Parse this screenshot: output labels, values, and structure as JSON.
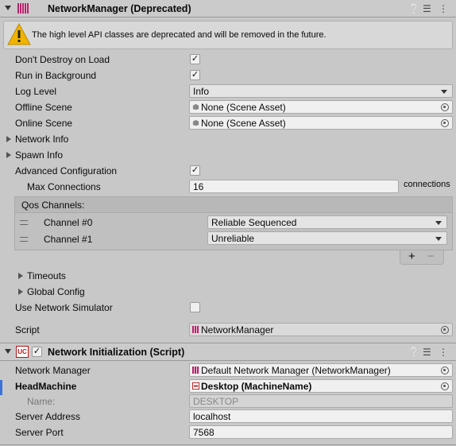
{
  "nm_component": {
    "title": "NetworkManager (Deprecated)",
    "warning": "The high level API classes are deprecated and will be removed in the future.",
    "dont_destroy_label": "Don't Destroy on Load",
    "run_bg_label": "Run in Background",
    "log_level_label": "Log Level",
    "log_level_value": "Info",
    "offline_scene_label": "Offline Scene",
    "offline_scene_value": "None (Scene Asset)",
    "online_scene_label": "Online Scene",
    "online_scene_value": "None (Scene Asset)",
    "network_info_label": "Network Info",
    "spawn_info_label": "Spawn Info",
    "adv_config_label": "Advanced Configuration",
    "max_conn_label": "Max Connections",
    "max_conn_value": "16",
    "max_conn_unit": "connections",
    "qos_label": "Qos Channels:",
    "channels": [
      {
        "label": "Channel #0",
        "value": "Reliable Sequenced"
      },
      {
        "label": "Channel #1",
        "value": "Unreliable"
      }
    ],
    "plus": "+",
    "minus": "−",
    "timeouts_label": "Timeouts",
    "global_config_label": "Global Config",
    "net_sim_label": "Use Network Simulator",
    "script_label": "Script",
    "script_value": "NetworkManager",
    "checkboxes": {
      "dont_destroy": true,
      "run_bg": true,
      "adv_config": true,
      "net_sim": false
    }
  },
  "ni_component": {
    "title": "Network Initialization (Script)",
    "icon_text": "UC",
    "enabled": true,
    "network_manager_label": "Network Manager",
    "network_manager_value": "Default Network Manager (NetworkManager)",
    "headmachine_label": "HeadMachine",
    "headmachine_value": "Desktop (MachineName)",
    "name_label": "Name:",
    "name_value": "DESKTOP",
    "server_address_label": "Server Address",
    "server_address_value": "localhost",
    "server_port_label": "Server Port",
    "server_port_value": "7568"
  },
  "icons": [
    "help-icon",
    "preset-icon",
    "kebab-menu-icon",
    "warning-icon",
    "object-picker-icon"
  ],
  "colors": {
    "accent": "#3a72d8",
    "warning": "#f0b400",
    "nm_icon": "#b5246a",
    "uc_icon": "#b21818"
  }
}
